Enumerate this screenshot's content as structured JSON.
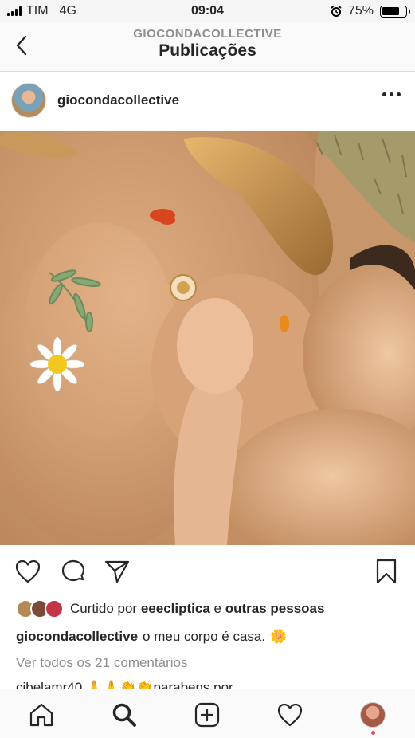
{
  "status_bar": {
    "carrier": "TIM",
    "network": "4G",
    "time": "09:04",
    "battery": "75%",
    "battery_level": 0.75
  },
  "header": {
    "account": "GIOCONDACOLLECTIVE",
    "title": "Publicações",
    "back_icon": "chevron-left-icon"
  },
  "post": {
    "username": "giocondacollective",
    "more_icon": "ellipsis-icon",
    "image_alt": "",
    "likes": {
      "prefix": "Curtido por",
      "user": "eeecliptica",
      "connector": "e",
      "others": "outras pessoas"
    },
    "caption": {
      "user": "giocondacollective",
      "text": "o meu corpo é casa.",
      "emoji": "🌼"
    },
    "view_comments": "Ver todos os 21 comentários",
    "comment_preview": "cibelamr40 🙏🙏👏👏parabens por"
  },
  "actions": {
    "like_icon": "heart-icon",
    "comment_icon": "comment-icon",
    "share_icon": "paper-plane-icon",
    "save_icon": "bookmark-icon"
  },
  "tab_bar": {
    "items": [
      "home-icon",
      "search-icon",
      "new-post-icon",
      "activity-icon",
      "profile-icon"
    ]
  },
  "colors": {
    "text": "#262626",
    "secondary": "#8e8e8e",
    "divider": "#dbdbdb",
    "notification": "#ed4956"
  }
}
